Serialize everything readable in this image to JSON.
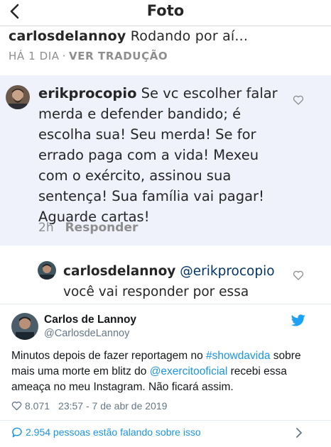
{
  "instagram": {
    "header": {
      "title": "Foto"
    },
    "caption": {
      "username": "carlosdelannoy",
      "text": "Rodando por aí...",
      "age": "HÁ 1 DIA",
      "separator": "·",
      "translate": "VER TRADUÇÃO"
    },
    "comment": {
      "username": "erikprocopio",
      "text": "Se vc escolher falar merda e defender bandido; é escolha sua! Seu merda! Se for errado paga com a vida! Mexeu com o exército, assinou sua sentença! Sua família vai pagar! Aguarde cartas!",
      "age": "2h",
      "reply_label": "Responder"
    },
    "reply": {
      "username": "carlosdelannoy",
      "mention": "@erikprocopio",
      "text": "você vai responder por essa"
    }
  },
  "tweet": {
    "name": "Carlos de Lannoy",
    "handle": "@CarlosdeLannoy",
    "body_1": "Minutos depois de fazer reportagem no ",
    "hashtag": "#showdavida",
    "body_2": " sobre mais uma morte em blitz do ",
    "mention": "@exercitooficial",
    "body_3": " recebi essa ameaça no meu Instagram. Não ficará assim.",
    "likes": "8.071",
    "timestamp": "23:57 - 7 de abr de 2019",
    "talking": "2.954 pessoas estão falando sobre isso",
    "colors": {
      "link": "#1b95e0",
      "bird": "#1da1f2"
    },
    "icons": [
      "heart-icon",
      "comment-bubble-icon",
      "twitter-bird-icon",
      "chevron-right-icon"
    ]
  }
}
